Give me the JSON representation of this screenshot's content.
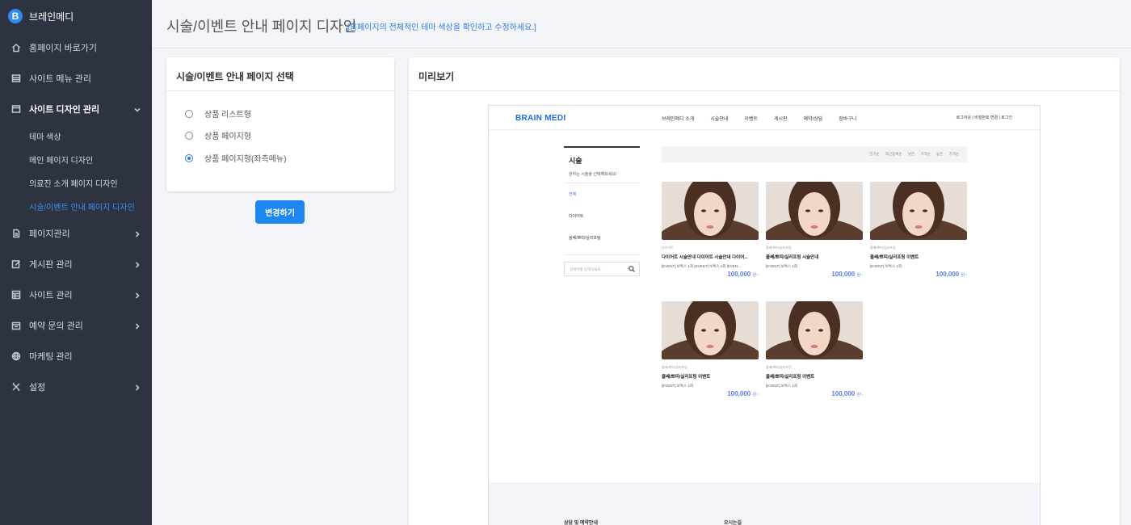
{
  "sidebar": {
    "brand_initial": "B",
    "brand_name": "브레인메디",
    "items": [
      {
        "label": "홈페이지 바로가기",
        "icon": "home-icon"
      },
      {
        "label": "사이트 메뉴 관리",
        "icon": "menu-icon"
      },
      {
        "label": "사이트 디자인 관리",
        "icon": "window-icon",
        "expanded": true,
        "sub": [
          "테마 색상",
          "메인 페이지 디자인",
          "의료진 소개 페이지 디자인",
          "시술/이벤트 안내 페이지 디자인"
        ],
        "current_sub": "시술/이벤트 안내 페이지 디자인"
      },
      {
        "label": "페이지관리",
        "icon": "file-icon"
      },
      {
        "label": "게시판 관리",
        "icon": "edit-icon"
      },
      {
        "label": "사이트 관리",
        "icon": "grid-icon"
      },
      {
        "label": "예약 문의 관리",
        "icon": "calendar-icon"
      },
      {
        "label": "마케팅 관리",
        "icon": "globe-icon"
      },
      {
        "label": "설정",
        "icon": "tools-icon"
      }
    ]
  },
  "header": {
    "title": "시술/이벤트 안내 페이지 디자인",
    "hint": "[홈페이지의 전체적인 테마 색상을 확인하고 수정하세요.]"
  },
  "select_panel": {
    "title": "시술/이벤트 안내 페이지 선택",
    "options": [
      "상품 리스트형",
      "상품 페이지형",
      "상품 페이지형(좌측메뉴)"
    ],
    "selected": "상품 페이지형(좌측메뉴)",
    "button_label": "변경하기"
  },
  "preview": {
    "title": "미리보기",
    "site": {
      "logo": "BRAIN MEDI",
      "nav": [
        "브레인메디 소개",
        "시술안내",
        "이벤트",
        "게시판",
        "예약/상담",
        "장바구니"
      ],
      "util": "로그아웃  |  비밀번호 변경  |  로그인",
      "side_title": "시술",
      "side_sub": "원하는 시술을 선택해보세요!",
      "side_categories": [
        "전체",
        "다이어트",
        "울쎄/쁘띠/실리프팅"
      ],
      "side_search_placeholder": "검색어를 입력하세요.",
      "sort_options": "인기순  최근등록순  낮은 가격순  높은 가격순",
      "products": [
        {
          "category": "다이어트",
          "name": "다이어트 시술안내 다이어트 시술안내 다이어...",
          "desc": "[EVENT] 보톡스 1회 [EVENT] 보톡스 1회 [EVEN...",
          "price": "100,000",
          "unit": "원~"
        },
        {
          "category": "울쎄/쁘띠/실리프팅",
          "name": "울쎄/쁘띠/실리프팅 시술안내",
          "desc": "[EVENT] 보톡스 1회",
          "price": "100,000",
          "unit": "원~"
        },
        {
          "category": "울쎄/쁘띠/실리프팅",
          "name": "울쎄/쁘띠/실리프팅 이벤트",
          "desc": "[EVENT] 보톡스 1회",
          "price": "100,000",
          "unit": "원~"
        },
        {
          "category": "울쎄/쁘띠/실리프팅",
          "name": "울쎄/쁘띠/실리프팅 이벤트",
          "desc": "[EVENT] 보톡스 1회",
          "price": "100,000",
          "unit": "원~"
        },
        {
          "category": "울쎄/쁘띠/실리프팅",
          "name": "울쎄/쁘띠/실리프팅 이벤트",
          "desc": "[EVENT] 보톡스 1회",
          "price": "100,000",
          "unit": "원~"
        }
      ],
      "footer_left": "상담 및 예약안내",
      "footer_right": "오시는길"
    }
  },
  "colors": {
    "sidebar_bg": "#2d3340",
    "accent": "#1d86f0",
    "current_sub": "#3a8ff3",
    "price": "#5b7be6"
  }
}
